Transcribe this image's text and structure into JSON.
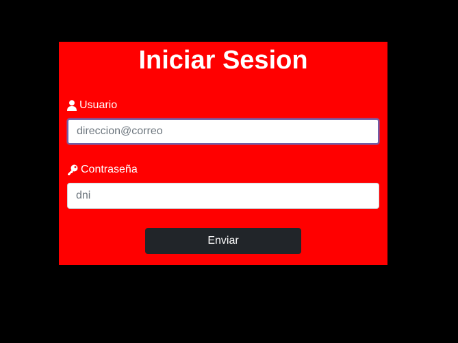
{
  "login_form": {
    "title": "Iniciar Sesion",
    "username": {
      "label": "Usuario",
      "icon": "user-icon",
      "value": "",
      "placeholder": "direccion@correo"
    },
    "password": {
      "label": "Contraseña",
      "icon": "key-icon",
      "value": "",
      "placeholder": "dni"
    },
    "submit_label": "Enviar"
  },
  "colors": {
    "page_background": "#000000",
    "panel_background": "#ff0000",
    "button_background": "#212529",
    "text": "#ffffff"
  }
}
